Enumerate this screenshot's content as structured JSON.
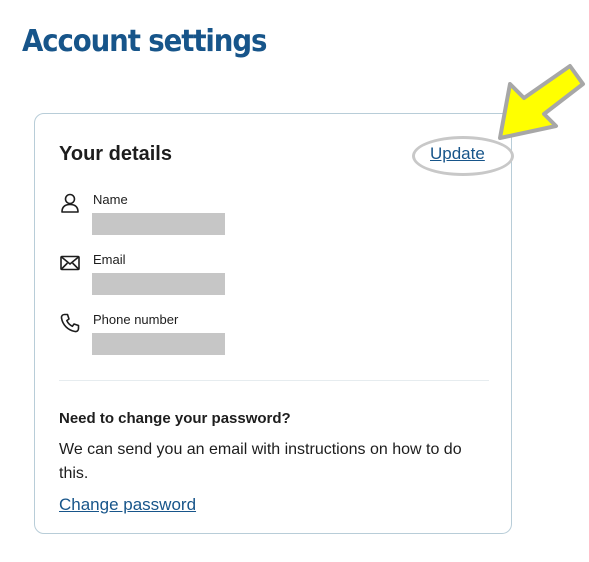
{
  "page": {
    "title": "Account settings"
  },
  "details_card": {
    "heading": "Your details",
    "update_label": "Update",
    "fields": [
      {
        "label": "Name",
        "icon": "person-icon"
      },
      {
        "label": "Email",
        "icon": "envelope-icon"
      },
      {
        "label": "Phone number",
        "icon": "phone-icon"
      }
    ]
  },
  "password": {
    "heading": "Need to change your password?",
    "description": "We can send you an email with instructions on how to do this.",
    "link_label": "Change password"
  },
  "colors": {
    "brand_blue": "#17558a",
    "card_border": "#b8cdd8",
    "redacted": "#c6c6c6",
    "highlight_arrow": "#ffff00"
  }
}
